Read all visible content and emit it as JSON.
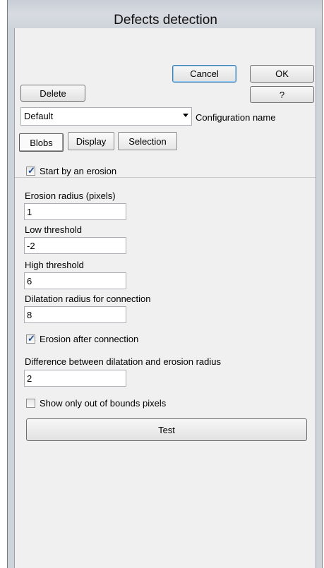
{
  "window": {
    "title": "Defects detection"
  },
  "buttons": {
    "cancel": "Cancel",
    "ok": "OK",
    "delete": "Delete",
    "help": "?",
    "test": "Test"
  },
  "configuration": {
    "value": "Default",
    "label": "Configuration name"
  },
  "tabs": [
    {
      "label": "Blobs",
      "active": true
    },
    {
      "label": "Display",
      "active": false
    },
    {
      "label": "Selection",
      "active": false
    }
  ],
  "blobs": {
    "start_erosion": {
      "label": "Start by an erosion",
      "checked": true
    },
    "erosion_radius": {
      "label": "Erosion radius (pixels)",
      "value": "1"
    },
    "low_threshold": {
      "label": "Low threshold",
      "value": "-2"
    },
    "high_threshold": {
      "label": "High threshold",
      "value": "6"
    },
    "dilatation_radius": {
      "label": "Dilatation radius for connection",
      "value": "8"
    },
    "erosion_after": {
      "label": "Erosion after connection",
      "checked": true
    },
    "difference": {
      "label": "Difference between dilatation and erosion radius",
      "value": "2"
    },
    "out_of_bounds": {
      "label": "Show only out of bounds pixels",
      "checked": false
    }
  }
}
